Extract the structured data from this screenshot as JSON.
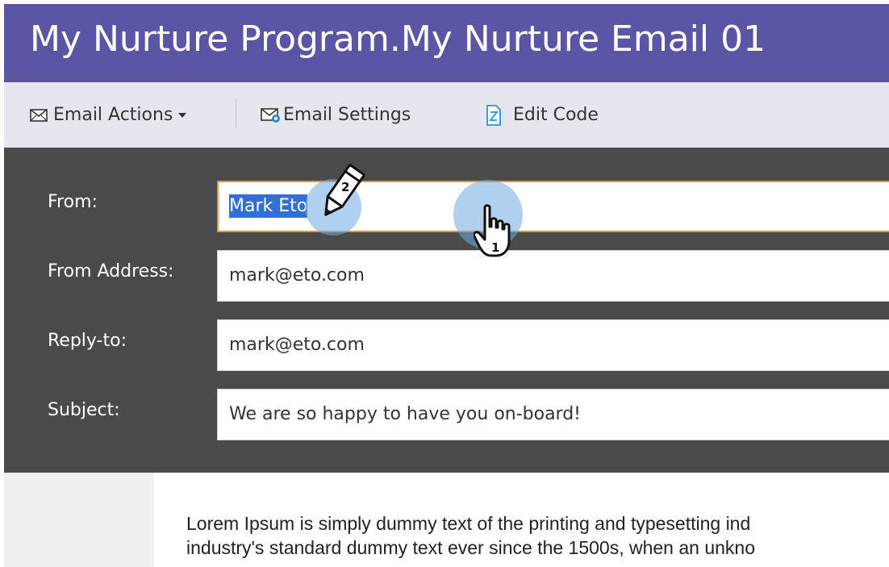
{
  "title": "My Nurture Program.My Nurture Email 01",
  "toolbar": {
    "email_actions": {
      "label": "Email Actions",
      "icon": "envelope-icon"
    },
    "email_settings": {
      "label": "Email Settings",
      "icon": "envelope-gear-icon"
    },
    "edit_code": {
      "label": "Edit Code",
      "icon": "code-file-icon"
    }
  },
  "fields": {
    "from": {
      "label": "From:",
      "value": "Mark Eto"
    },
    "from_address": {
      "label": "From Address:",
      "value": "mark@eto.com"
    },
    "reply_to": {
      "label": "Reply-to:",
      "value": "mark@eto.com"
    },
    "subject": {
      "label": "Subject:",
      "value": "We are so happy to have you on-board!"
    }
  },
  "body": {
    "line1": "Lorem Ipsum is simply dummy text of the printing and typesetting ind",
    "line2": "industry's standard dummy text ever since the 1500s, when an unkno"
  },
  "annotations": {
    "step1": "1",
    "step2": "2",
    "step1_icon": "hand-pointer-icon",
    "step2_icon": "pencil-icon"
  },
  "colors": {
    "title_bar": "#5a55a5",
    "toolbar": "#e6e6ee",
    "panel": "#4a4a4a",
    "active_border": "#e8962a",
    "selection": "#2f6fd6"
  }
}
